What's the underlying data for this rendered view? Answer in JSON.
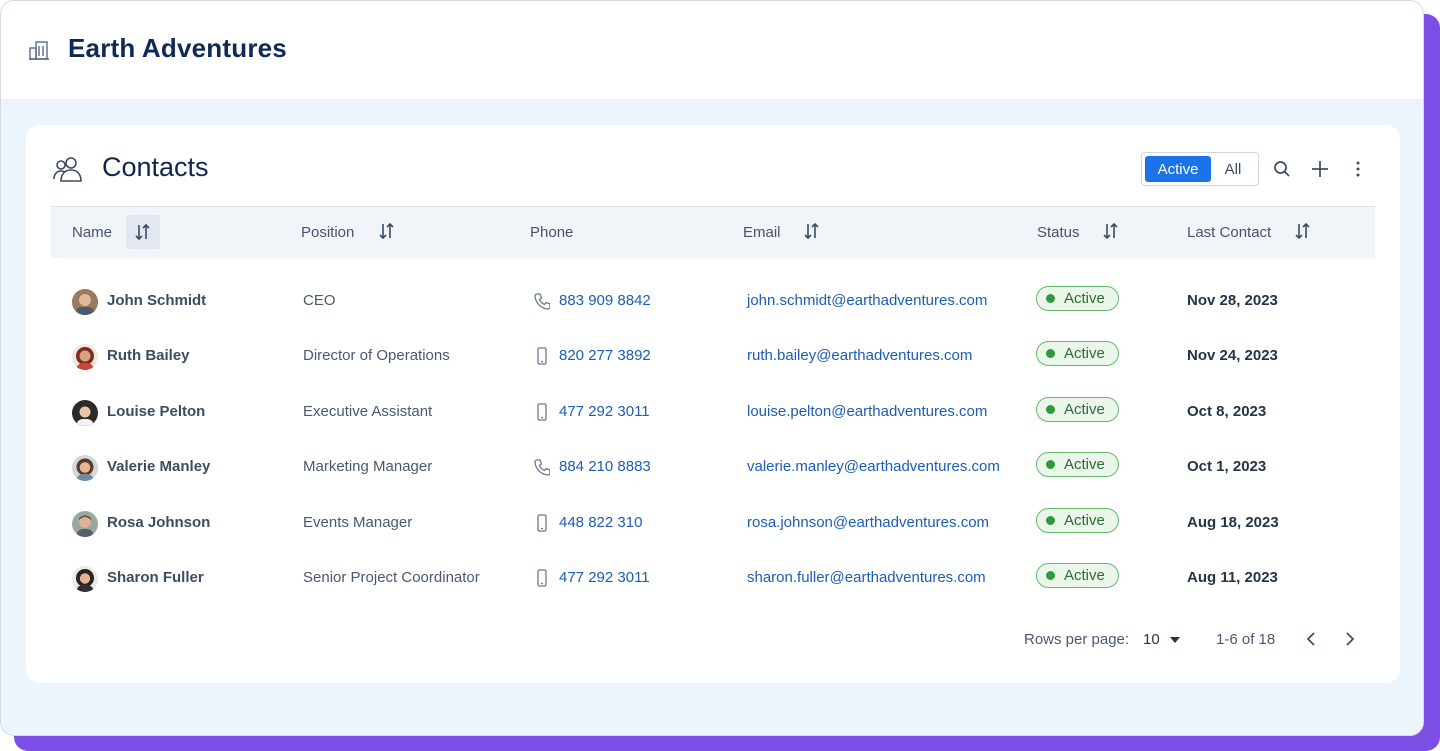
{
  "app": {
    "title": "Earth Adventures"
  },
  "contacts": {
    "title": "Contacts",
    "filter": {
      "active_label": "Active",
      "all_label": "All"
    },
    "columns": {
      "name": "Name",
      "position": "Position",
      "phone": "Phone",
      "email": "Email",
      "status": "Status",
      "last_contact": "Last Contact"
    },
    "rows": [
      {
        "name": "John Schmidt",
        "position": "CEO",
        "phone_type": "phone-icon",
        "phone": "883 909 8842",
        "email": "john.schmidt@earthadventures.com",
        "status": "Active",
        "last_contact": "Nov 28, 2023"
      },
      {
        "name": "Ruth Bailey",
        "position": "Director of Operations",
        "phone_type": "mobile-icon",
        "phone": "820 277 3892",
        "email": "ruth.bailey@earthadventures.com",
        "status": "Active",
        "last_contact": "Nov 24, 2023"
      },
      {
        "name": "Louise Pelton",
        "position": "Executive Assistant",
        "phone_type": "mobile-icon",
        "phone": "477 292 3011",
        "email": "louise.pelton@earthadventures.com",
        "status": "Active",
        "last_contact": "Oct 8, 2023"
      },
      {
        "name": "Valerie Manley",
        "position": "Marketing Manager",
        "phone_type": "phone-icon",
        "phone": "884 210 8883",
        "email": "valerie.manley@earthadventures.com",
        "status": "Active",
        "last_contact": "Oct 1, 2023"
      },
      {
        "name": "Rosa Johnson",
        "position": "Events Manager",
        "phone_type": "mobile-icon",
        "phone": "448 822 310",
        "email": "rosa.johnson@earthadventures.com",
        "status": "Active",
        "last_contact": "Aug 18, 2023"
      },
      {
        "name": "Sharon Fuller",
        "position": "Senior Project Coordinator",
        "phone_type": "mobile-icon",
        "phone": "477 292 3011",
        "email": "sharon.fuller@earthadventures.com",
        "status": "Active",
        "last_contact": "Aug 11, 2023"
      }
    ],
    "pagination": {
      "rows_per_page_label": "Rows per page:",
      "rows_per_page": "10",
      "range": "1-6 of 18"
    }
  },
  "colors": {
    "accent": "#1a73e8",
    "brand_purple": "#7b4ee6",
    "status_active": "#2e9a3f",
    "link": "#1b5db8"
  },
  "icons": {
    "header": "building-icon",
    "card": "contacts-icon",
    "search": "search-icon",
    "add": "plus-icon",
    "more": "more-vertical-icon",
    "sort": "sort-arrows-icon",
    "prev": "chevron-left-icon",
    "next": "chevron-right-icon",
    "dropdown": "caret-down-icon"
  }
}
